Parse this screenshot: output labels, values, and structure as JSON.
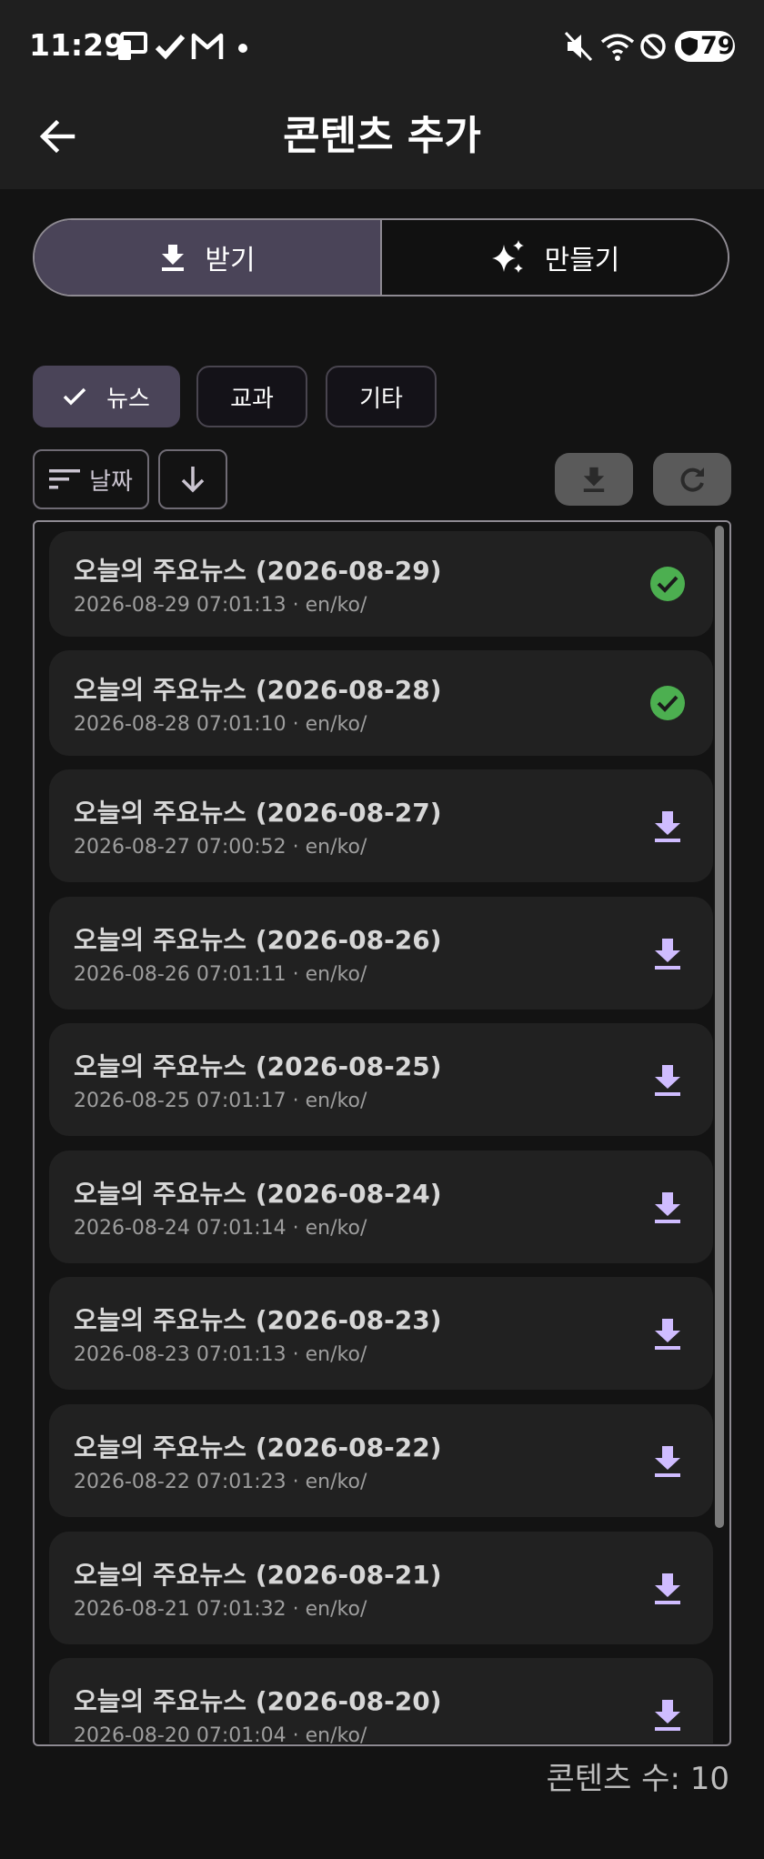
{
  "status_bar": {
    "time": "11:29",
    "battery": "79",
    "icons": [
      "screen-cast-icon",
      "check-icon",
      "gmail-icon",
      "dot-icon",
      "mute-icon",
      "wifi-icon",
      "dnd-icon",
      "battery-icon"
    ]
  },
  "app_bar": {
    "title": "콘텐츠 추가",
    "back_icon": "arrow-back-icon"
  },
  "segmented": {
    "receive_label": "받기",
    "create_label": "만들기"
  },
  "chips": [
    {
      "label": "뉴스",
      "selected": true
    },
    {
      "label": "교과",
      "selected": false
    },
    {
      "label": "기타",
      "selected": false
    }
  ],
  "sort": {
    "label": "날짜"
  },
  "items": [
    {
      "title": "오늘의 주요뉴스 (2026-08-29)",
      "subtitle": "2026-08-29 07:01:13 · en/ko/",
      "status": "downloaded"
    },
    {
      "title": "오늘의 주요뉴스 (2026-08-28)",
      "subtitle": "2026-08-28 07:01:10 · en/ko/",
      "status": "downloaded"
    },
    {
      "title": "오늘의 주요뉴스 (2026-08-27)",
      "subtitle": "2026-08-27 07:00:52 · en/ko/",
      "status": "download"
    },
    {
      "title": "오늘의 주요뉴스 (2026-08-26)",
      "subtitle": "2026-08-26 07:01:11 · en/ko/",
      "status": "download"
    },
    {
      "title": "오늘의 주요뉴스 (2026-08-25)",
      "subtitle": "2026-08-25 07:01:17 · en/ko/",
      "status": "download"
    },
    {
      "title": "오늘의 주요뉴스 (2026-08-24)",
      "subtitle": "2026-08-24 07:01:14 · en/ko/",
      "status": "download"
    },
    {
      "title": "오늘의 주요뉴스 (2026-08-23)",
      "subtitle": "2026-08-23 07:01:13 · en/ko/",
      "status": "download"
    },
    {
      "title": "오늘의 주요뉴스 (2026-08-22)",
      "subtitle": "2026-08-22 07:01:23 · en/ko/",
      "status": "download"
    },
    {
      "title": "오늘의 주요뉴스 (2026-08-21)",
      "subtitle": "2026-08-21 07:01:32 · en/ko/",
      "status": "download"
    },
    {
      "title": "오늘의 주요뉴스 (2026-08-20)",
      "subtitle": "2026-08-20 07:01:04 · en/ko/",
      "status": "download"
    }
  ],
  "footer": {
    "count_text": "콘텐츠 수: 10"
  },
  "colors": {
    "accent": "#cfbcff",
    "success": "#4caf50",
    "selected": "#4a4458"
  }
}
